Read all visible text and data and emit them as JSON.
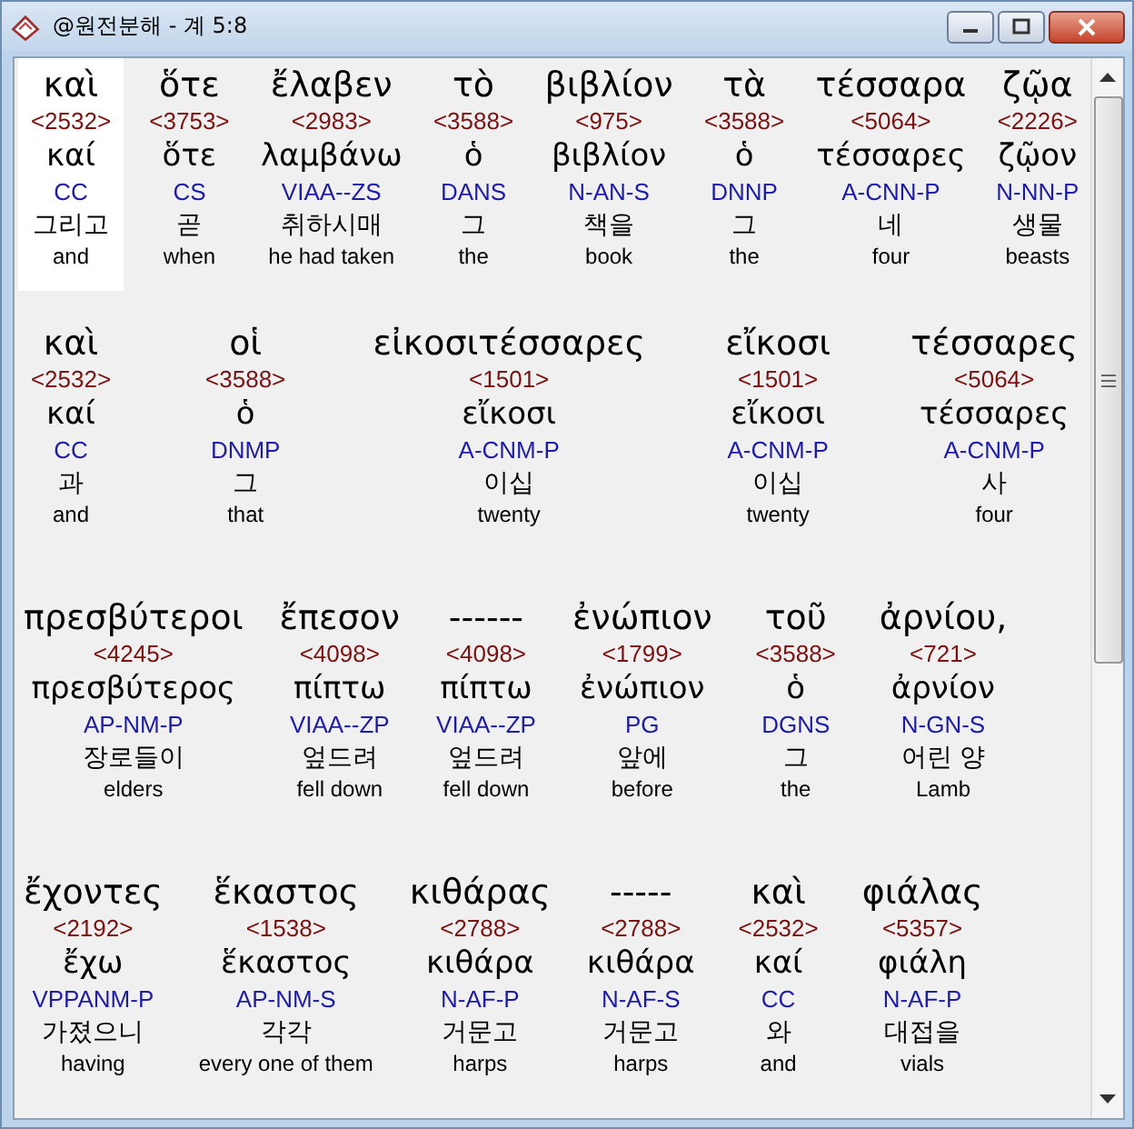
{
  "window": {
    "title": "@원전분해 - 계 5:8"
  },
  "lines": [
    {
      "words": [
        {
          "greek": "καὶ",
          "strong": "<2532>",
          "lemma": "καί",
          "parsing": "CC",
          "korean": "그리고",
          "english": "and",
          "selected": true
        },
        {
          "greek": "ὅτε",
          "strong": "<3753>",
          "lemma": "ὅτε",
          "parsing": "CS",
          "korean": "곧",
          "english": "when",
          "selected": false
        },
        {
          "greek": "ἔλαβεν",
          "strong": "<2983>",
          "lemma": "λαμβάνω",
          "parsing": "VIAA--ZS",
          "korean": "취하시매",
          "english": "he had taken",
          "selected": false
        },
        {
          "greek": "τὸ",
          "strong": "<3588>",
          "lemma": "ὁ",
          "parsing": "DANS",
          "korean": "그",
          "english": "the",
          "selected": false
        },
        {
          "greek": "βιβλίον",
          "strong": "<975>",
          "lemma": "βιβλίον",
          "parsing": "N-AN-S",
          "korean": "책을",
          "english": "book",
          "selected": false
        },
        {
          "greek": "τὰ",
          "strong": "<3588>",
          "lemma": "ὁ",
          "parsing": "DNNP",
          "korean": "그",
          "english": "the",
          "selected": false
        },
        {
          "greek": "τέσσαρα",
          "strong": "<5064>",
          "lemma": "τέσσαρες",
          "parsing": "A-CNN-P",
          "korean": "네",
          "english": "four",
          "selected": false
        },
        {
          "greek": "ζῷα",
          "strong": "<2226>",
          "lemma": "ζῷον",
          "parsing": "N-NN-P",
          "korean": "생물",
          "english": "beasts",
          "selected": false
        }
      ]
    },
    {
      "words": [
        {
          "greek": "καὶ",
          "strong": "<2532>",
          "lemma": "καί",
          "parsing": "CC",
          "korean": "과",
          "english": "and",
          "selected": false
        },
        {
          "greek": "οἱ",
          "strong": "<3588>",
          "lemma": "ὁ",
          "parsing": "DNMP",
          "korean": "그",
          "english": "that",
          "selected": false
        },
        {
          "greek": "εἰκοσιτέσσαρες",
          "strong": "<1501>",
          "lemma": "εἴκοσι",
          "parsing": "A-CNM-P",
          "korean": "이십",
          "english": "twenty",
          "selected": false
        },
        {
          "greek": "εἴκοσι",
          "strong": "<1501>",
          "lemma": "εἴκοσι",
          "parsing": "A-CNM-P",
          "korean": "이십",
          "english": "twenty",
          "selected": false
        },
        {
          "greek": "τέσσαρες",
          "strong": "<5064>",
          "lemma": "τέσσαρες",
          "parsing": "A-CNM-P",
          "korean": "사",
          "english": "four",
          "selected": false
        }
      ]
    },
    {
      "words": [
        {
          "greek": "πρεσβύτεροι",
          "strong": "<4245>",
          "lemma": "πρεσβύτερος",
          "parsing": "AP-NM-P",
          "korean": "장로들이",
          "english": "elders",
          "selected": false
        },
        {
          "greek": "ἔπεσον",
          "strong": "<4098>",
          "lemma": "πίπτω",
          "parsing": "VIAA--ZP",
          "korean": "엎드려",
          "english": "fell down",
          "selected": false
        },
        {
          "greek": "------",
          "strong": "<4098>",
          "lemma": "πίπτω",
          "parsing": "VIAA--ZP",
          "korean": "엎드려",
          "english": "fell down",
          "selected": false
        },
        {
          "greek": "ἐνώπιον",
          "strong": "<1799>",
          "lemma": "ἐνώπιον",
          "parsing": "PG",
          "korean": "앞에",
          "english": "before",
          "selected": false
        },
        {
          "greek": "τοῦ",
          "strong": "<3588>",
          "lemma": "ὁ",
          "parsing": "DGNS",
          "korean": "그",
          "english": "the",
          "selected": false
        },
        {
          "greek": "ἀρνίου,",
          "strong": "<721>",
          "lemma": "ἀρνίον",
          "parsing": "N-GN-S",
          "korean": "어린 양",
          "english": "Lamb",
          "selected": false
        }
      ]
    },
    {
      "words": [
        {
          "greek": "ἔχοντες",
          "strong": "<2192>",
          "lemma": "ἔχω",
          "parsing": "VPPANM-P",
          "korean": "가졌으니",
          "english": "having",
          "selected": false
        },
        {
          "greek": "ἕκαστος",
          "strong": "<1538>",
          "lemma": "ἕκαστος",
          "parsing": "AP-NM-S",
          "korean": "각각",
          "english": "every one of them",
          "selected": false
        },
        {
          "greek": "κιθάρας",
          "strong": "<2788>",
          "lemma": "κιθάρα",
          "parsing": "N-AF-P",
          "korean": "거문고",
          "english": "harps",
          "selected": false
        },
        {
          "greek": "-----",
          "strong": "<2788>",
          "lemma": "κιθάρα",
          "parsing": "N-AF-S",
          "korean": "거문고",
          "english": "harps",
          "selected": false
        },
        {
          "greek": "καὶ",
          "strong": "<2532>",
          "lemma": "καί",
          "parsing": "CC",
          "korean": "와",
          "english": "and",
          "selected": false
        },
        {
          "greek": "φιάλας",
          "strong": "<5357>",
          "lemma": "φιάλη",
          "parsing": "N-AF-P",
          "korean": "대접을",
          "english": "vials",
          "selected": false
        }
      ]
    }
  ]
}
